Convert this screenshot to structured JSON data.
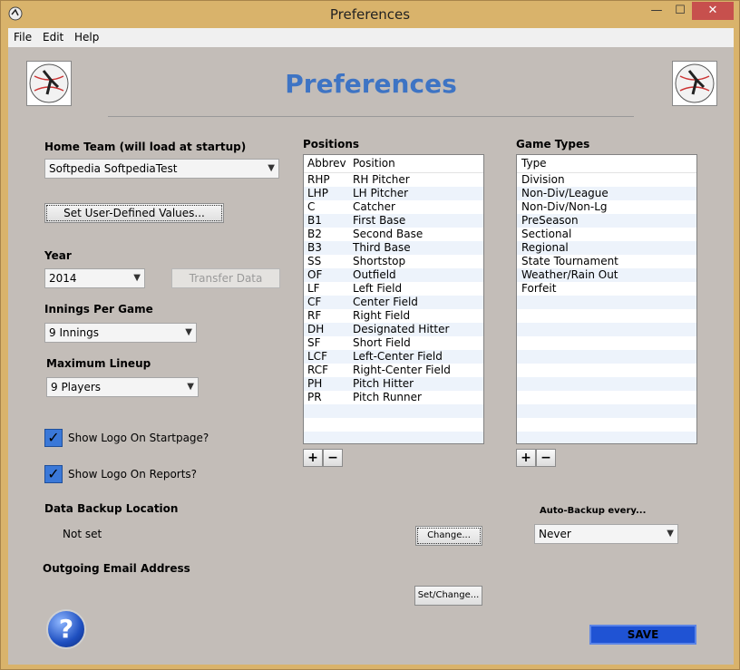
{
  "window": {
    "title": "Preferences",
    "controls": {
      "minimize": "—",
      "maximize": "☐",
      "close": "✕"
    }
  },
  "menu": {
    "file": "File",
    "edit": "Edit",
    "help": "Help"
  },
  "header": {
    "title": "Preferences",
    "logo_icon": "baseball-player-logo"
  },
  "home_team": {
    "label": "Home Team (will load at startup)",
    "selected": "Softpedia SoftpediaTest",
    "set_values_button": "Set User-Defined Values..."
  },
  "year": {
    "label": "Year",
    "selected": "2014",
    "transfer_button": "Transfer Data"
  },
  "innings": {
    "label": "Innings Per Game",
    "selected": "9 Innings"
  },
  "lineup": {
    "label": "Maximum Lineup",
    "selected": "9 Players"
  },
  "checkboxes": {
    "logo_startpage": {
      "label": "Show Logo On Startpage?",
      "checked": true
    },
    "logo_reports": {
      "label": "Show Logo On Reports?",
      "checked": true
    }
  },
  "backup": {
    "label": "Data Backup Location",
    "value": "Not set",
    "change_button": "Change...",
    "auto_label": "Auto-Backup every...",
    "auto_selected": "Never"
  },
  "email": {
    "label": "Outgoing Email Address",
    "set_button": "Set/Change..."
  },
  "positions": {
    "title": "Positions",
    "col_abbrev": "Abbrev",
    "col_position": "Position",
    "rows": [
      [
        "RHP",
        "RH Pitcher"
      ],
      [
        "LHP",
        "LH Pitcher"
      ],
      [
        "C",
        "Catcher"
      ],
      [
        "B1",
        "First Base"
      ],
      [
        "B2",
        "Second Base"
      ],
      [
        "B3",
        "Third Base"
      ],
      [
        "SS",
        "Shortstop"
      ],
      [
        "OF",
        "Outfield"
      ],
      [
        "LF",
        "Left Field"
      ],
      [
        "CF",
        "Center Field"
      ],
      [
        "RF",
        "Right Field"
      ],
      [
        "DH",
        "Designated Hitter"
      ],
      [
        "SF",
        "Short Field"
      ],
      [
        "LCF",
        "Left-Center Field"
      ],
      [
        "RCF",
        "Right-Center Field"
      ],
      [
        "PH",
        "Pitch Hitter"
      ],
      [
        "PR",
        "Pitch Runner"
      ]
    ],
    "add": "+",
    "remove": "−"
  },
  "game_types": {
    "title": "Game Types",
    "col_type": "Type",
    "rows": [
      "Division",
      "Non-Div/League",
      "Non-Div/Non-Lg",
      "PreSeason",
      "Sectional",
      "Regional",
      "State Tournament",
      "Weather/Rain Out",
      "Forfeit"
    ],
    "add": "+",
    "remove": "−"
  },
  "footer": {
    "help": "?",
    "save": "SAVE"
  }
}
